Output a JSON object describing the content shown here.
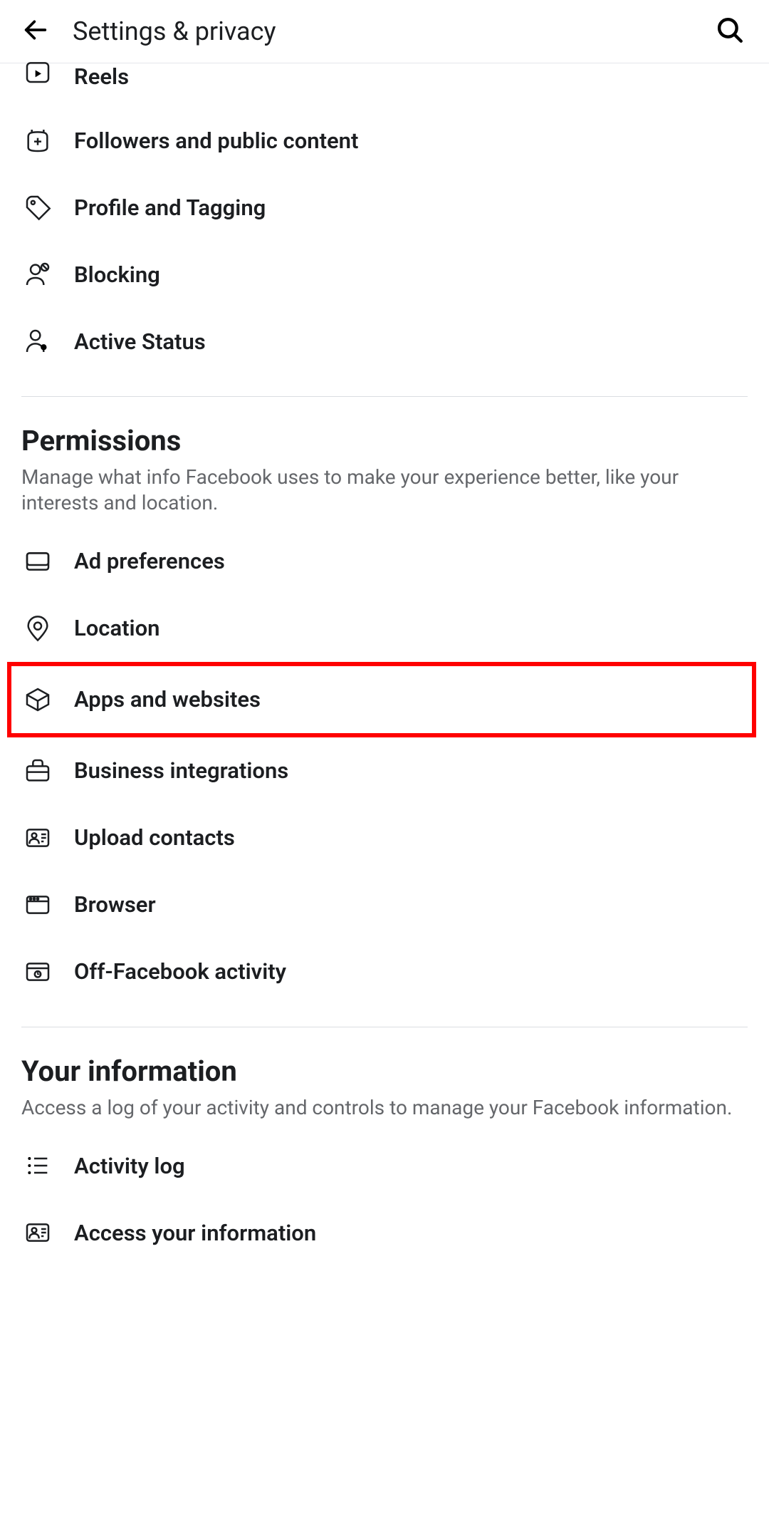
{
  "header": {
    "title": "Settings & privacy"
  },
  "sections": [
    {
      "items": [
        {
          "label": "Reels"
        },
        {
          "label": "Followers and public content"
        },
        {
          "label": "Profile and Tagging"
        },
        {
          "label": "Blocking"
        },
        {
          "label": "Active Status"
        }
      ]
    },
    {
      "title": "Permissions",
      "description": "Manage what info Facebook uses to make your experience better, like your interests and location.",
      "items": [
        {
          "label": "Ad preferences"
        },
        {
          "label": "Location"
        },
        {
          "label": "Apps and websites"
        },
        {
          "label": "Business integrations"
        },
        {
          "label": "Upload contacts"
        },
        {
          "label": "Browser"
        },
        {
          "label": "Off-Facebook activity"
        }
      ]
    },
    {
      "title": "Your information",
      "description": "Access a log of your activity and controls to manage your Facebook information.",
      "items": [
        {
          "label": "Activity log"
        },
        {
          "label": "Access your information"
        }
      ]
    }
  ]
}
